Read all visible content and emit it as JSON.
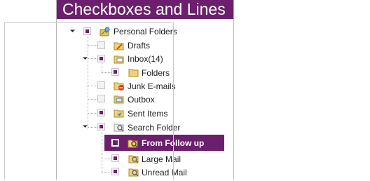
{
  "panel": {
    "title": "Checkboxes and Lines"
  },
  "tree": [
    {
      "id": "personal-folders",
      "label": "Personal Folders",
      "checked": true,
      "expanded": true,
      "icon": "personal-folders-icon"
    },
    {
      "id": "drafts",
      "label": "Drafts",
      "checked": false,
      "icon": "drafts-folder-icon"
    },
    {
      "id": "inbox",
      "label": "Inbox(14)",
      "checked": true,
      "expanded": true,
      "icon": "inbox-folder-icon"
    },
    {
      "id": "folders",
      "label": "Folders",
      "checked": true,
      "icon": "folder-icon"
    },
    {
      "id": "junk",
      "label": "Junk E-mails",
      "checked": false,
      "icon": "junk-folder-icon"
    },
    {
      "id": "outbox",
      "label": "Outbox",
      "checked": false,
      "icon": "outbox-folder-icon"
    },
    {
      "id": "sent",
      "label": "Sent Items",
      "checked": true,
      "icon": "sent-folder-icon"
    },
    {
      "id": "search",
      "label": "Search Folder",
      "checked": true,
      "expanded": true,
      "icon": "search-folder-icon"
    },
    {
      "id": "follow-up",
      "label": "From Follow up",
      "checked": false,
      "selected": true,
      "icon": "search-folder-icon"
    },
    {
      "id": "large-mail",
      "label": "Large Mail",
      "checked": true,
      "icon": "search-folder-icon"
    },
    {
      "id": "unread-mail",
      "label": "Unread Mail",
      "checked": true,
      "icon": "search-folder-icon"
    }
  ],
  "colors": {
    "accent": "#6b1f6c",
    "header_text": "#ffffff"
  }
}
